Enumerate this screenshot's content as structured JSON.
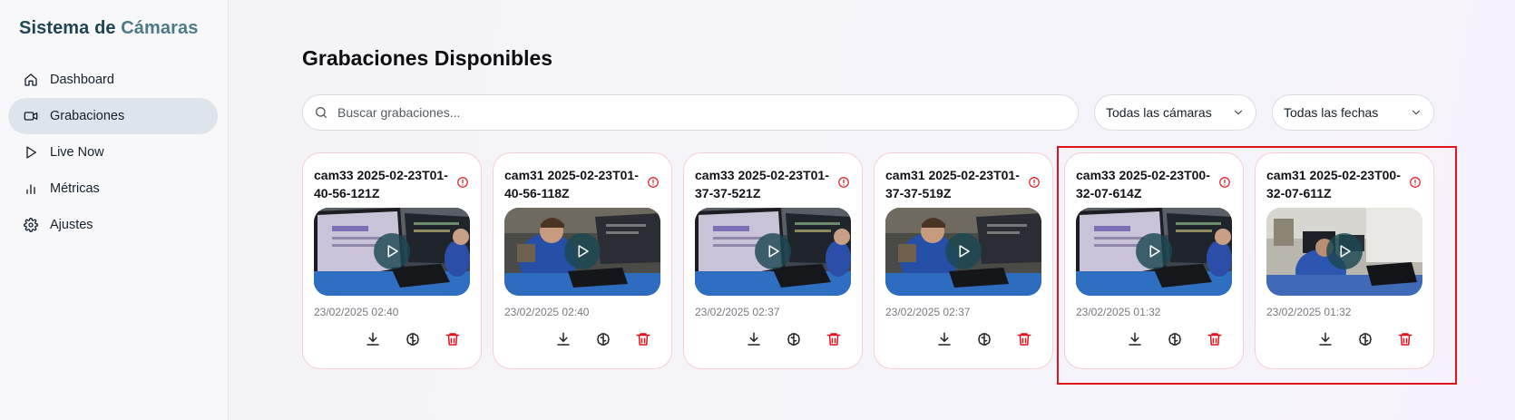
{
  "brand": {
    "part1": "Sistema de ",
    "part2": "Cámaras"
  },
  "nav": [
    {
      "label": "Dashboard",
      "icon": "home-icon",
      "active": false
    },
    {
      "label": "Grabaciones",
      "icon": "video-icon",
      "active": true
    },
    {
      "label": "Live Now",
      "icon": "play-icon",
      "active": false
    },
    {
      "label": "Métricas",
      "icon": "bar-chart-icon",
      "active": false
    },
    {
      "label": "Ajustes",
      "icon": "gear-icon",
      "active": false
    }
  ],
  "main": {
    "title": "Grabaciones Disponibles",
    "search_placeholder": "Buscar grabaciones...",
    "camera_filter": "Todas las cámaras",
    "date_filter": "Todas las fechas"
  },
  "recordings": [
    {
      "title": "cam33 2025-02-23T01-40-56-121Z",
      "date": "23/02/2025 02:40",
      "scene": "monitor"
    },
    {
      "title": "cam31 2025-02-23T01-40-56-118Z",
      "date": "23/02/2025 02:40",
      "scene": "person"
    },
    {
      "title": "cam33 2025-02-23T01-37-37-521Z",
      "date": "23/02/2025 02:37",
      "scene": "monitor"
    },
    {
      "title": "cam31 2025-02-23T01-37-37-519Z",
      "date": "23/02/2025 02:37",
      "scene": "person"
    },
    {
      "title": "cam33 2025-02-23T00-32-07-614Z",
      "date": "23/02/2025 01:32",
      "scene": "monitor"
    },
    {
      "title": "cam31 2025-02-23T00-32-07-611Z",
      "date": "23/02/2025 01:32",
      "scene": "room"
    }
  ],
  "colors": {
    "accent": "#1f4552",
    "danger": "#e0141c",
    "card_border": "#f6cfd6"
  }
}
